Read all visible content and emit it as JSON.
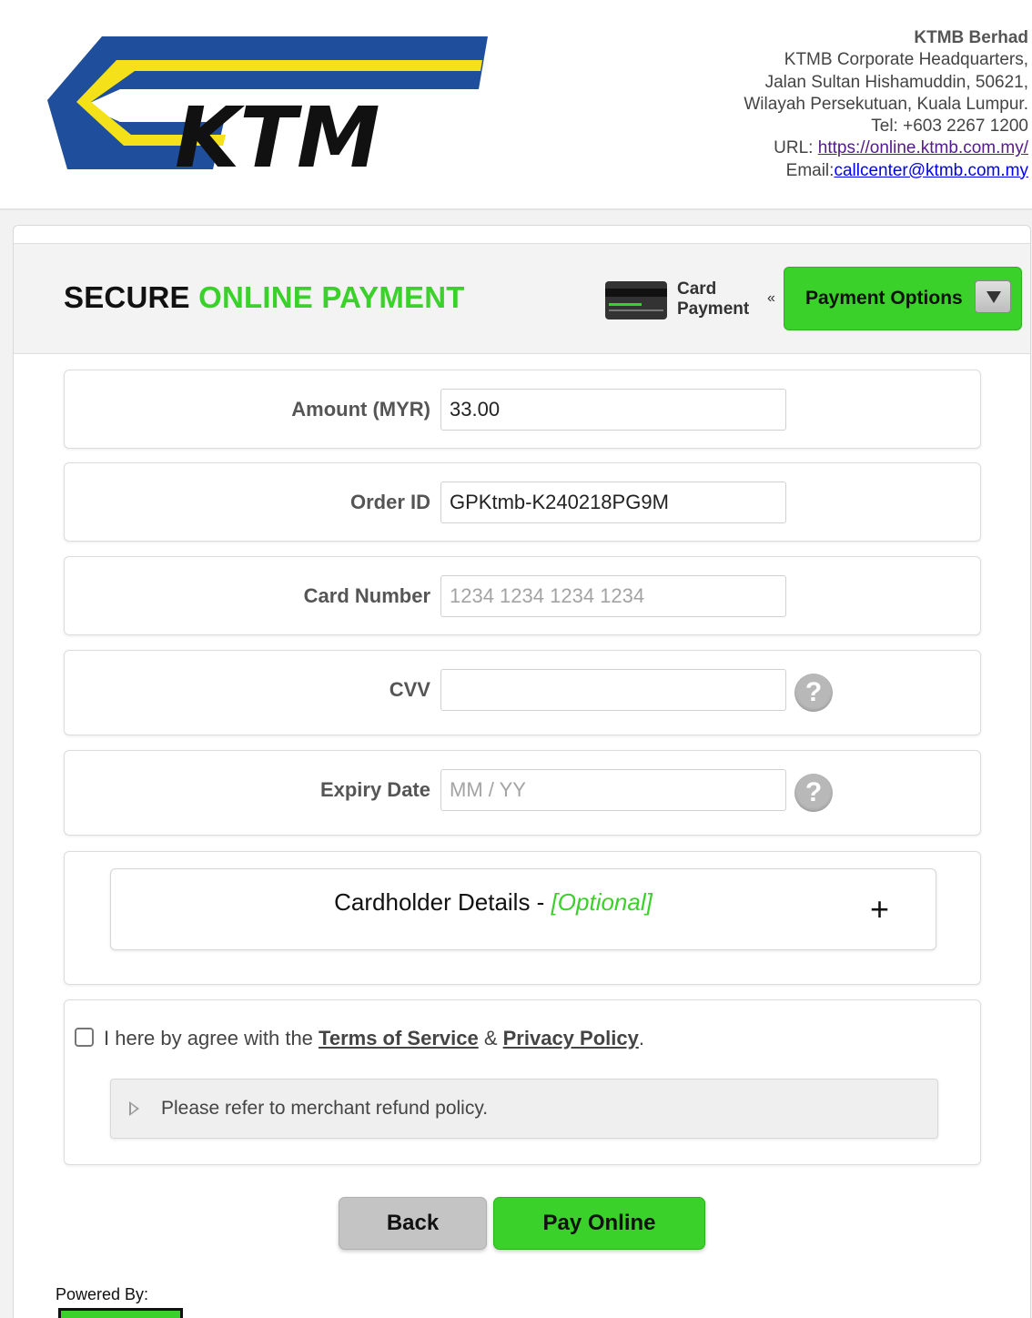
{
  "header": {
    "logo_text": "KTM",
    "company": {
      "name": "KTMB Berhad",
      "address_line1": "KTMB Corporate Headquarters,",
      "address_line2": "Jalan Sultan Hishamuddin, 50621,",
      "address_line3": "Wilayah Persekutuan, Kuala Lumpur.",
      "tel": "Tel: +603 2267 1200",
      "url_label": "URL: ",
      "url": "https://online.ktmb.com.my/",
      "email_label": "Email:",
      "email": "callcenter@ktmb.com.my"
    }
  },
  "payment": {
    "title_part1": "SECURE ",
    "title_part2": "ONLINE PAYMENT",
    "method_line1": "Card",
    "method_line2": "Payment",
    "separator": "«",
    "options_button": "Payment Options"
  },
  "form": {
    "amount_label": "Amount (MYR)",
    "amount_value": "33.00",
    "order_label": "Order ID",
    "order_value": "GPKtmb-K240218PG9M",
    "card_label": "Card Number",
    "card_placeholder": "1234 1234 1234 1234",
    "card_value": "",
    "cvv_label": "CVV",
    "cvv_value": "",
    "expiry_label": "Expiry Date",
    "expiry_placeholder": "MM / YY",
    "expiry_value": "",
    "help_glyph": "?"
  },
  "cardholder": {
    "title": "Cardholder Details - ",
    "optional": "[Optional]",
    "expand_glyph": "+"
  },
  "agreement": {
    "text_before": "I here by agree with the ",
    "terms": "Terms of Service",
    "amp": " & ",
    "privacy": "Privacy Policy",
    "period": ".",
    "refund_note": "Please refer to merchant refund policy."
  },
  "buttons": {
    "back": "Back",
    "pay": "Pay Online"
  },
  "footer": {
    "powered_by": "Powered By:"
  },
  "colors": {
    "accent_green": "#3ad12a",
    "logo_blue": "#1f4e9c",
    "logo_yellow": "#f5e11a"
  }
}
